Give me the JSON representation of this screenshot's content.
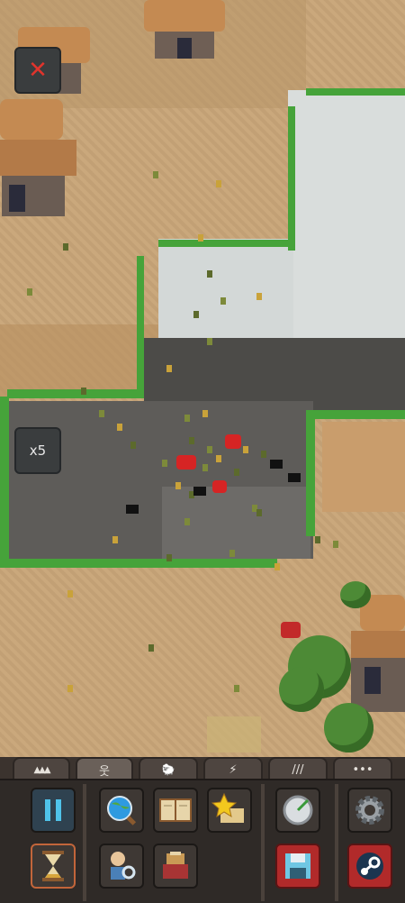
{
  "overlay": {
    "close_icon": "close-x-icon",
    "speed_label": "x5"
  },
  "tabs": [
    {
      "icon": "terrain-icon",
      "glyph": "▲▲▲"
    },
    {
      "icon": "human-icon",
      "glyph": "웃"
    },
    {
      "icon": "creature-icon",
      "glyph": "🐑"
    },
    {
      "icon": "disaster-icon",
      "glyph": "⚡"
    },
    {
      "icon": "tools-icon",
      "glyph": "///"
    },
    {
      "icon": "more-icon",
      "glyph": "•••"
    }
  ],
  "buttons": [
    {
      "name": "pause-button",
      "icon": "pause-icon"
    },
    {
      "name": "world-inspect-button",
      "icon": "globe-magnifier-icon"
    },
    {
      "name": "world-laws-button",
      "icon": "book-icon"
    },
    {
      "name": "achievements-button",
      "icon": "star-scroll-icon"
    },
    {
      "name": "clock-button",
      "icon": "radar-icon"
    },
    {
      "name": "settings-button",
      "icon": "gear-icon"
    },
    {
      "name": "time-speed-button",
      "icon": "hourglass-icon"
    },
    {
      "name": "unit-inspect-button",
      "icon": "person-magnifier-icon"
    },
    {
      "name": "history-button",
      "icon": "history-book-icon"
    },
    {
      "name": "save-button",
      "icon": "floppy-disk-icon"
    },
    {
      "name": "steam-button",
      "icon": "steam-icon"
    }
  ],
  "colors": {
    "sand": "#c9a679",
    "road": "#5e5c59",
    "water": "#d8dcdb",
    "border": "#46a33a",
    "accent_red": "#b12a2a"
  }
}
